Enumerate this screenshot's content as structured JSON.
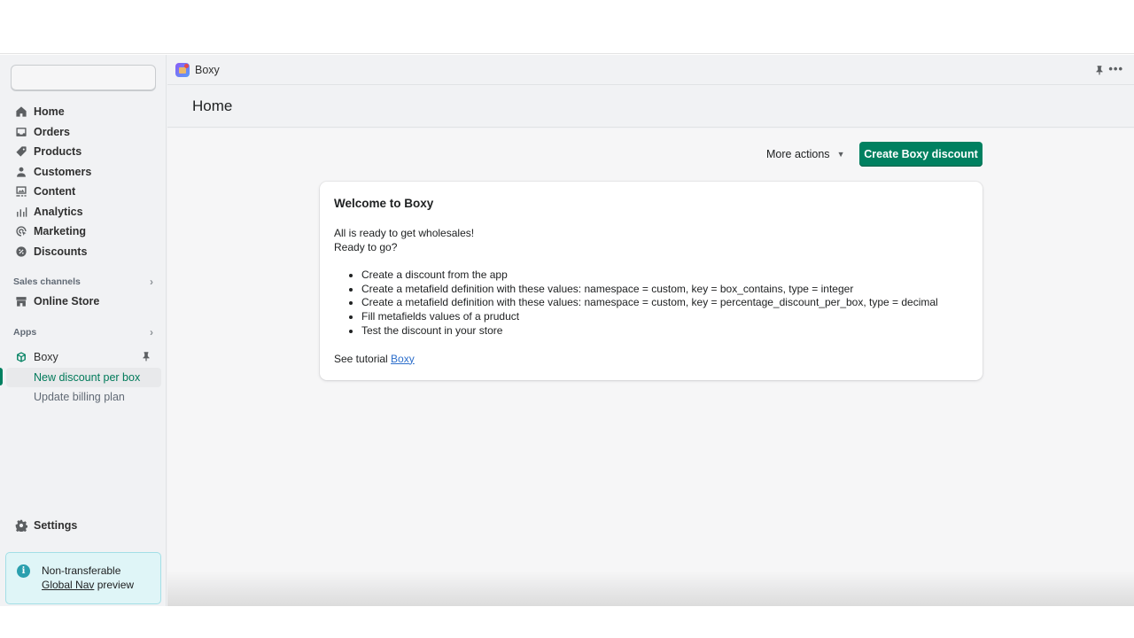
{
  "sidebar": {
    "search": {
      "placeholder": ""
    },
    "items": [
      {
        "label": "Home",
        "icon": "home-icon"
      },
      {
        "label": "Orders",
        "icon": "inbox-icon"
      },
      {
        "label": "Products",
        "icon": "tag-icon"
      },
      {
        "label": "Customers",
        "icon": "person-icon"
      },
      {
        "label": "Content",
        "icon": "image-icon"
      },
      {
        "label": "Analytics",
        "icon": "bar-chart-icon"
      },
      {
        "label": "Marketing",
        "icon": "target-icon"
      },
      {
        "label": "Discounts",
        "icon": "discount-icon"
      }
    ],
    "sales_channels": {
      "heading": "Sales channels",
      "items": [
        {
          "label": "Online Store",
          "icon": "store-icon"
        }
      ]
    },
    "apps": {
      "heading": "Apps",
      "app": {
        "label": "Boxy",
        "icon": "box-icon"
      },
      "subitems": [
        {
          "label": "New discount per box",
          "active": true
        },
        {
          "label": "Update billing plan",
          "active": false
        }
      ]
    },
    "settings": {
      "label": "Settings",
      "icon": "gear-icon"
    },
    "notice": {
      "line1": "Non-transferable",
      "link": "Global Nav",
      "suffix": " preview"
    }
  },
  "app_bar": {
    "app_name": "Boxy",
    "more_glyph": "•••"
  },
  "page": {
    "title": "Home",
    "more_actions": "More actions",
    "caret": "▼",
    "primary_action": "Create Boxy discount"
  },
  "card": {
    "title": "Welcome to Boxy",
    "intro_line1": "All is ready to get wholesales!",
    "intro_line2": "Ready to go?",
    "steps": [
      "Create a discount from the app",
      "Create a metafield definition with these values: namespace = custom, key = box_contains, type = integer",
      "Create a metafield definition with these values: namespace = custom, key = percentage_discount_per_box, type = decimal",
      "Fill metafields values of a pruduct",
      "Test the discount in your store"
    ],
    "tutorial_prefix": "See tutorial ",
    "tutorial_link": "Boxy"
  },
  "colors": {
    "primary": "#008060",
    "active_nav": "#007a5a",
    "link": "#2c6ecb",
    "notice_bg": "#dff5f7"
  }
}
